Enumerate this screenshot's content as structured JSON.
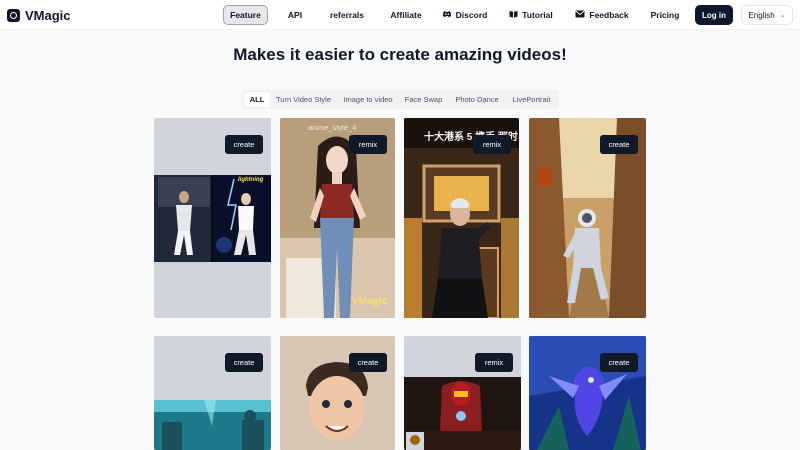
{
  "app": {
    "name": "VMagic",
    "brand_color": "#111827"
  },
  "header": {
    "nav": [
      {
        "label": "Feature",
        "icon": "",
        "active": true
      },
      {
        "label": "API",
        "icon": ""
      },
      {
        "label": "referrals",
        "icon": ""
      },
      {
        "label": "Affiliate",
        "icon": ""
      },
      {
        "label": "Discord",
        "icon": "discord-icon"
      },
      {
        "label": "Tutorial",
        "icon": "book-icon"
      },
      {
        "label": "Feedback",
        "icon": "mail-icon"
      },
      {
        "label": "Pricing",
        "icon": ""
      }
    ],
    "login_label": "Log in",
    "language": "English"
  },
  "headline": "Makes it easier to create amazing videos!",
  "tabs": [
    {
      "label": "ALL",
      "active": true
    },
    {
      "label": "Turn Video Style"
    },
    {
      "label": "Image to video"
    },
    {
      "label": "Face Swap"
    },
    {
      "label": "Photo Dance"
    },
    {
      "label": "LivePortrait"
    }
  ],
  "cards": [
    {
      "button": "create",
      "overlay": "lightning"
    },
    {
      "button": "remix",
      "overlay": "anime_style_4",
      "watermark": "VMagic"
    },
    {
      "button": "remix",
      "overlay": "十大港系 5.携手 那时"
    },
    {
      "button": "create"
    },
    {
      "button": "create"
    },
    {
      "button": "create"
    },
    {
      "button": "remix"
    },
    {
      "button": "create"
    }
  ]
}
